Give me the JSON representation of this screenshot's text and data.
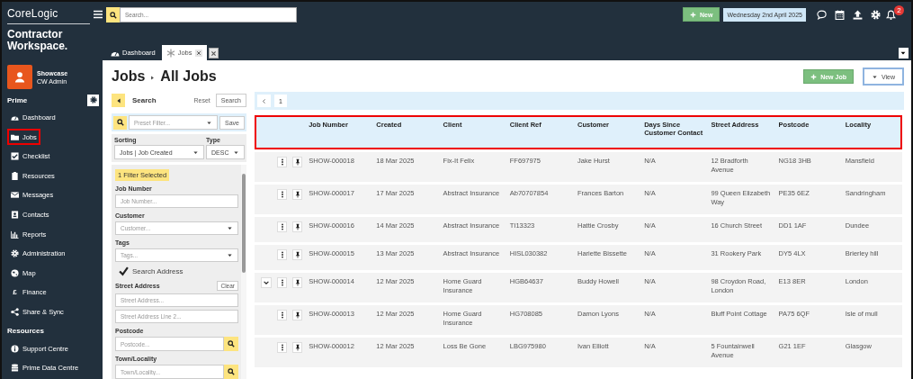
{
  "brand": {
    "company": "CoreLogic",
    "product": "Contractor Workspace."
  },
  "user": {
    "name": "Showcase",
    "role": "CW Admin"
  },
  "sidebar": {
    "sections": [
      {
        "title": "Prime",
        "settings": true,
        "items": [
          {
            "label": "Dashboard",
            "highlighted": false
          },
          {
            "label": "Jobs",
            "highlighted": true
          },
          {
            "label": "Checklist",
            "highlighted": false
          },
          {
            "label": "Resources",
            "highlighted": false
          },
          {
            "label": "Messages",
            "highlighted": false
          },
          {
            "label": "Contacts",
            "highlighted": false
          },
          {
            "label": "Reports",
            "highlighted": false
          },
          {
            "label": "Administration",
            "highlighted": false
          },
          {
            "label": "Map",
            "highlighted": false
          },
          {
            "label": "Finance",
            "icon_text": "£",
            "highlighted": false
          },
          {
            "label": "Share & Sync",
            "highlighted": false
          }
        ]
      },
      {
        "title": "Resources",
        "settings": false,
        "items": [
          {
            "label": "Support Centre",
            "highlighted": false
          },
          {
            "label": "Prime Data Centre",
            "highlighted": false
          }
        ]
      }
    ]
  },
  "topbar": {
    "search_placeholder": "Search...",
    "new_button": "New",
    "date": "Wednesday 2nd April 2025",
    "notifications": "2"
  },
  "tabs": [
    {
      "label": "Dashboard",
      "selected": false,
      "closable": false
    },
    {
      "label": "Jobs",
      "selected": true,
      "closable": true
    }
  ],
  "breadcrumb": [
    "Jobs",
    "All Jobs"
  ],
  "actions": {
    "new_job": "New Job",
    "view": "View"
  },
  "filters": {
    "title": "Search",
    "reset": "Reset",
    "search_button": "Search",
    "preset_placeholder": "Preset Filter...",
    "save": "Save",
    "sorting_label": "Sorting",
    "sorting_value": "Jobs | Job Created",
    "type_label": "Type",
    "type_value": "DESC",
    "selected_count": "1 Filter Selected",
    "fields": [
      {
        "kind": "text",
        "label": "Job Number",
        "placeholder": "Job Number..."
      },
      {
        "kind": "select",
        "label": "Customer",
        "placeholder": "Customer..."
      },
      {
        "kind": "select",
        "label": "Tags",
        "placeholder": "Tags..."
      },
      {
        "kind": "checkbox",
        "label": "Search Address",
        "checked": true
      },
      {
        "kind": "text",
        "label": "Street Address",
        "action": "Clear",
        "placeholder": "Street Address..."
      },
      {
        "kind": "text",
        "placeholder": "Street Address Line 2..."
      },
      {
        "kind": "search",
        "label": "Postcode",
        "placeholder": "Postcode..."
      },
      {
        "kind": "search",
        "label": "Town/Locality",
        "placeholder": "Town/Locality..."
      }
    ]
  },
  "pagination": {
    "pages": [
      {
        "label": "1",
        "selected": true
      }
    ]
  },
  "table": {
    "header_highlighted": true,
    "columns": [
      "Job Number",
      "Created",
      "Client",
      "Client Ref",
      "Customer",
      "Days Since Customer Contact",
      "Street Address",
      "Postcode",
      "Locality"
    ],
    "rows": [
      {
        "expandable": false,
        "cells": [
          "SHOW-000018",
          "18 Mar 2025",
          "Fix-It Felix",
          "FF697975",
          "Jake Hurst",
          "N/A",
          "12 Bradforth Avenue",
          "NG18 3HB",
          "Mansfield"
        ]
      },
      {
        "expandable": false,
        "cells": [
          "SHOW-000017",
          "17 Mar 2025",
          "Abstract Insurance",
          "Ab70707854",
          "Frances Barton",
          "N/A",
          "99 Queen Elizabeth Way",
          "PE35 6EZ",
          "Sandringham"
        ]
      },
      {
        "expandable": false,
        "cells": [
          "SHOW-000016",
          "14 Mar 2025",
          "Abstract Insurance",
          "TI13323",
          "Hattie Crosby",
          "N/A",
          "16 Church Street",
          "DD1 1AF",
          "Dundee"
        ]
      },
      {
        "expandable": false,
        "cells": [
          "SHOW-000015",
          "13 Mar 2025",
          "Abstract Insurance",
          "HISL030382",
          "Hariette Bissette",
          "N/A",
          "31 Rookery Park",
          "DY5 4LX",
          "Brierley hill"
        ]
      },
      {
        "expandable": true,
        "cells": [
          "SHOW-000014",
          "12 Mar 2025",
          "Home Guard Insurance",
          "HGB64637",
          "Buddy Howell",
          "N/A",
          "98 Croydon Road, London",
          "E13 8ER",
          "London"
        ]
      },
      {
        "expandable": false,
        "cells": [
          "SHOW-000013",
          "12 Mar 2025",
          "Home Guard Insurance",
          "HG708085",
          "Damon Lyons",
          "N/A",
          "Bluff Point Cottage",
          "PA75 6QF",
          "Isle of mull"
        ]
      },
      {
        "expandable": false,
        "cells": [
          "SHOW-000012",
          "12 Mar 2025",
          "Loss Be Gone",
          "LBG975980",
          "Ivan Elliott",
          "N/A",
          "5 Fountainwell Avenue",
          "G21 1EF",
          "Glasgow"
        ]
      }
    ]
  }
}
